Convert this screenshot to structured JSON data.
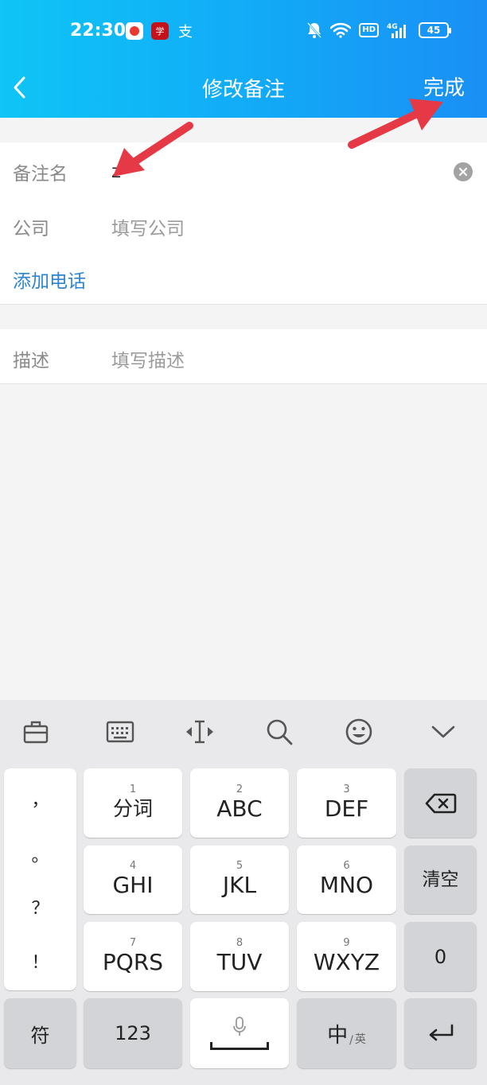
{
  "status_bar": {
    "time": "22:30",
    "app_icons": [
      "video-app-icon",
      "brand-app-icon",
      "pay-app-icon"
    ],
    "pay_glyph": "支",
    "brand_glyph": "学",
    "network": "4G",
    "hd": "HD",
    "battery": "45"
  },
  "nav": {
    "title": "修改备注",
    "done_label": "完成"
  },
  "form": {
    "remark_label": "备注名",
    "remark_value": "z",
    "company_label": "公司",
    "company_placeholder": "填写公司",
    "add_phone_label": "添加电话",
    "description_label": "描述",
    "description_placeholder": "填写描述"
  },
  "keyboard": {
    "toolbar": [
      "toolbox-icon",
      "keyboard-icon",
      "cursor-move-icon",
      "search-icon",
      "emoji-icon",
      "collapse-icon"
    ],
    "punctuation": [
      "，",
      "。",
      "？",
      "！"
    ],
    "keys": [
      {
        "num": "1",
        "label": "分词"
      },
      {
        "num": "2",
        "label": "ABC"
      },
      {
        "num": "3",
        "label": "DEF"
      },
      {
        "num": "4",
        "label": "GHI"
      },
      {
        "num": "5",
        "label": "JKL"
      },
      {
        "num": "6",
        "label": "MNO"
      },
      {
        "num": "7",
        "label": "PQRS"
      },
      {
        "num": "8",
        "label": "TUV"
      },
      {
        "num": "9",
        "label": "WXYZ"
      }
    ],
    "clear_label": "清空",
    "zero_label": "0",
    "symbol_label": "符",
    "num_label": "123",
    "lang_main": "中",
    "lang_sub": "英"
  },
  "colors": {
    "header_start": "#0ec5f6",
    "header_end": "#1a8ff5",
    "link_blue": "#2d84cf",
    "annotation_red": "#e63946"
  }
}
